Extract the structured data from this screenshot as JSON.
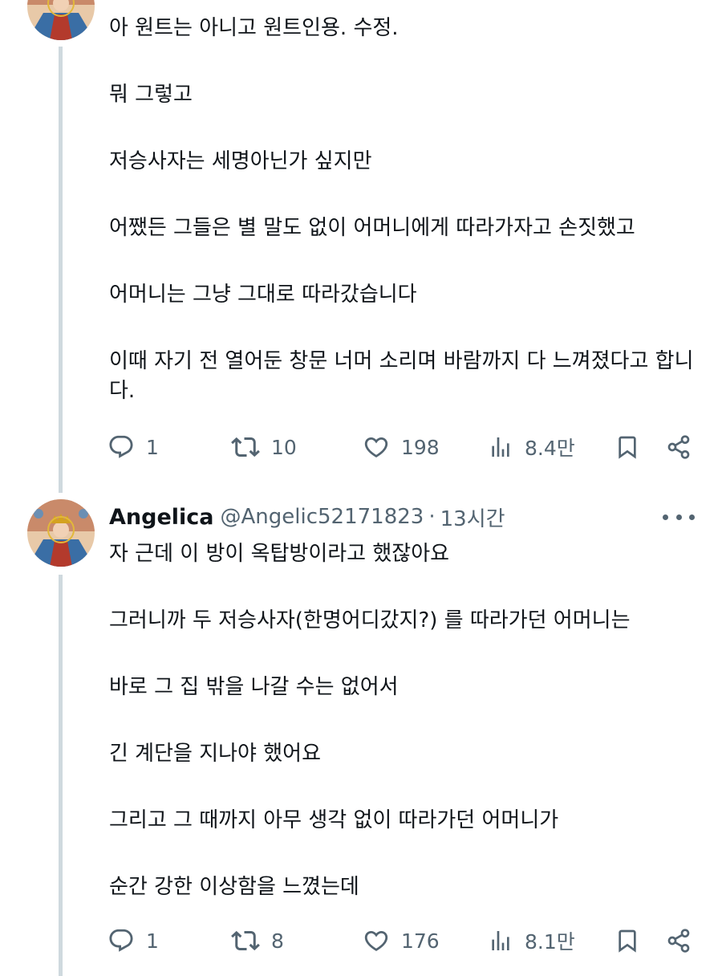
{
  "tweet1": {
    "paragraphs": [
      "아 원트는 아니고 원트인용. 수정.",
      "뭐 그렇고",
      "저승사자는 세명아닌가 싶지만",
      "어쨌든 그들은 별 말도 없이 어머니에게 따라가자고 손짓했고",
      "어머니는 그냥 그대로 따라갔습니다",
      "이때 자기 전 열어둔 창문 너머 소리며 바람까지 다 느껴졌다고 합니다."
    ],
    "actions": {
      "replies": "1",
      "retweets": "10",
      "likes": "198",
      "views": "8.4만"
    }
  },
  "tweet2": {
    "display_name": "Angelica",
    "handle": "@Angelic52171823",
    "separator": "·",
    "time": "13시간",
    "paragraphs": [
      "자 근데 이 방이 옥탑방이라고 했잖아요",
      "그러니까 두 저승사자(한명어디갔지?) 를 따라가던 어머니는",
      "바로 그 집 밖을 나갈 수는 없어서",
      "긴 계단을 지나야 했어요",
      "그리고 그 때까지 아무 생각 없이 따라가던 어머니가",
      "순간 강한 이상함을 느꼈는데"
    ],
    "actions": {
      "replies": "1",
      "retweets": "8",
      "likes": "176",
      "views": "8.1만"
    }
  },
  "icons": {
    "reply": "reply-icon",
    "retweet": "retweet-icon",
    "like": "heart-icon",
    "views": "views-chart-icon",
    "bookmark": "bookmark-icon",
    "share": "share-icon",
    "more": "more-dots-icon"
  },
  "colors": {
    "text": "#0f1419",
    "secondary": "#536471",
    "thread_line": "#cfd9de"
  }
}
